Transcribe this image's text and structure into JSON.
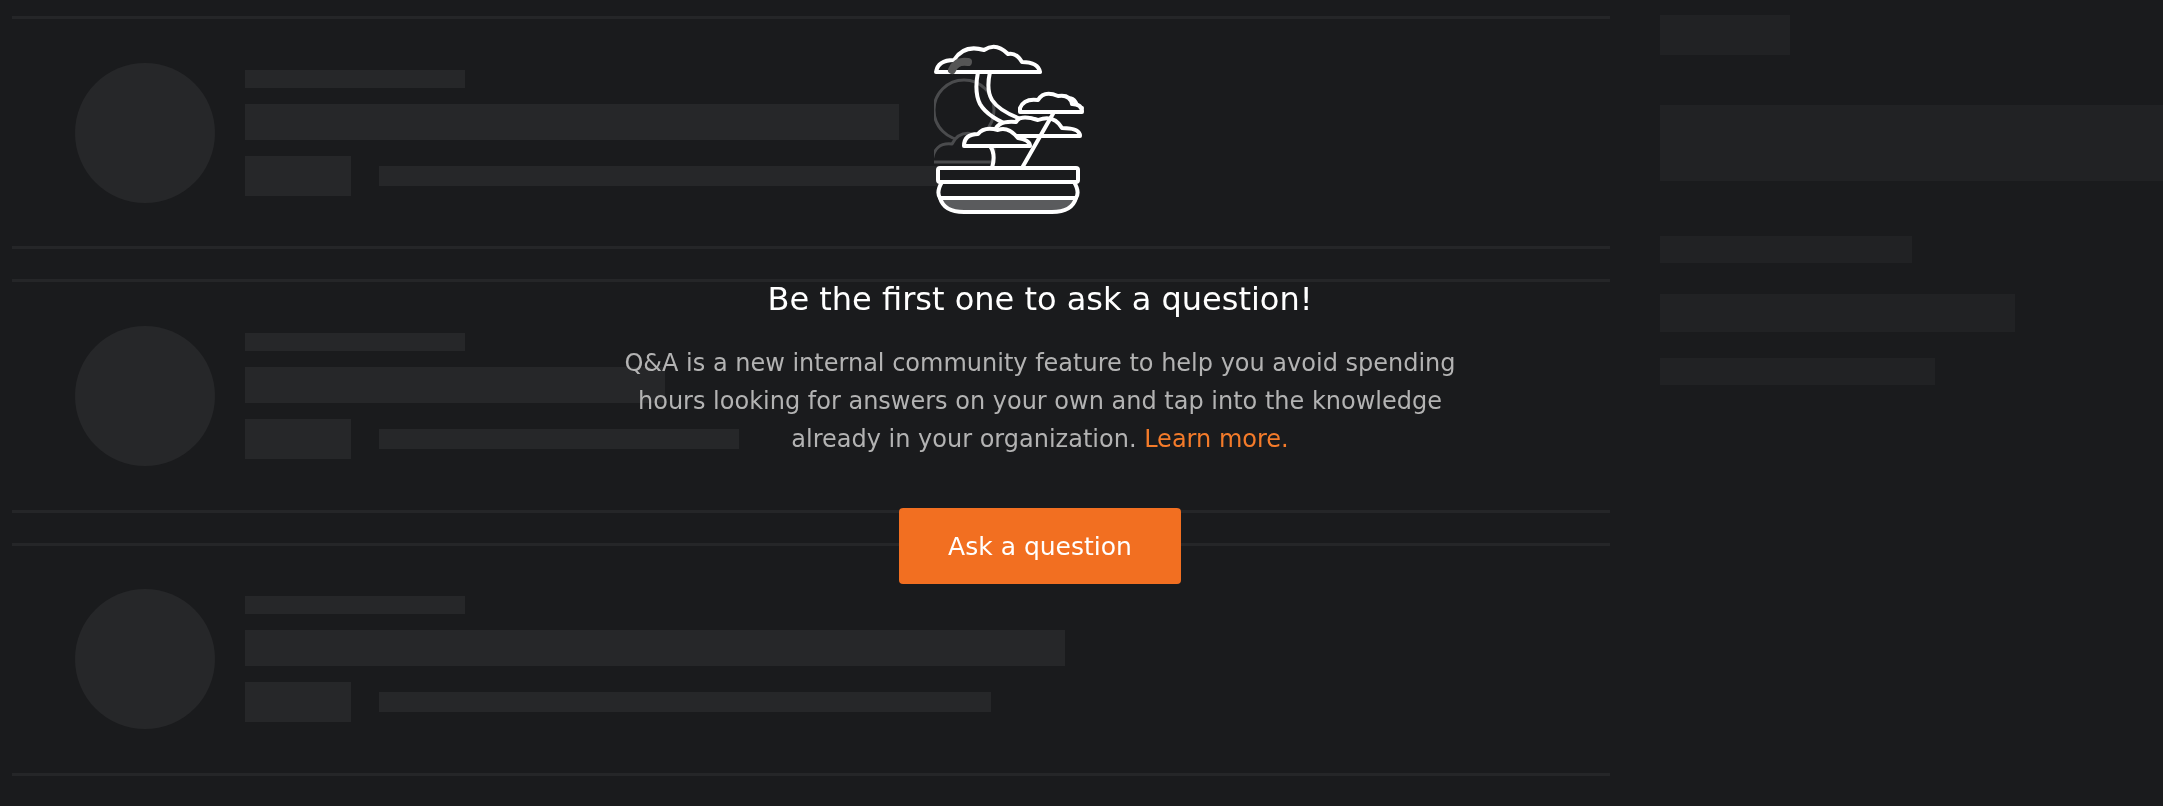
{
  "empty_state": {
    "title": "Be the first one to ask a question!",
    "description": "Q&A is a new internal community feature to help you avoid spending hours looking for answers on your own and tap into the knowledge already in your organization.",
    "link": "Learn more.",
    "button": "Ask a question"
  }
}
